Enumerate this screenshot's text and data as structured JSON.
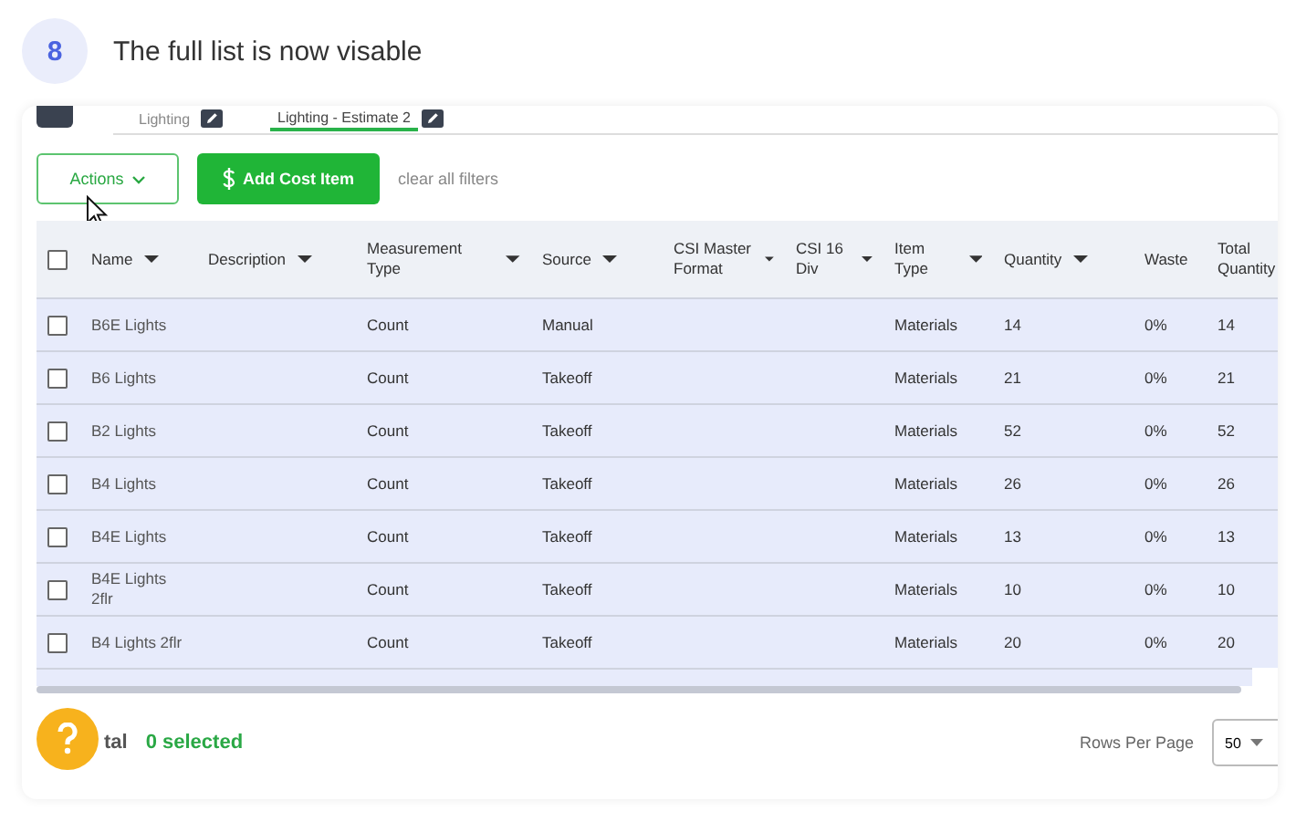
{
  "step": {
    "number": "8",
    "caption": "The full list is now visable"
  },
  "tabs": [
    {
      "label": "Lighting",
      "selected": false
    },
    {
      "label": "Lighting - Estimate 2",
      "selected": true
    }
  ],
  "toolbar": {
    "actions": "Actions",
    "add": "Add Cost Item",
    "clear": "clear all filters"
  },
  "table": {
    "select_all": {
      "checked": false
    },
    "columns": [
      {
        "label": "Name",
        "filter": true
      },
      {
        "label": "Description",
        "filter": true
      },
      {
        "label": "Measurement Type",
        "filter": true
      },
      {
        "label": "Source",
        "filter": true
      },
      {
        "label": "CSI Master Format",
        "filter": true
      },
      {
        "label": "CSI 16 Div",
        "filter": true
      },
      {
        "label": "Item Type",
        "filter": true
      },
      {
        "label": "Quantity",
        "filter": true
      },
      {
        "label": "Waste",
        "filter": false
      },
      {
        "label": "Total Quantity",
        "filter": false
      }
    ],
    "rows": [
      {
        "checked": false,
        "cells": [
          "B6E Lights",
          "",
          "Count",
          "Manual",
          "",
          "",
          "Materials",
          "14",
          "0%",
          "14"
        ]
      },
      {
        "checked": false,
        "cells": [
          "B6 Lights",
          "",
          "Count",
          "Takeoff",
          "",
          "",
          "Materials",
          "21",
          "0%",
          "21"
        ]
      },
      {
        "checked": false,
        "cells": [
          "B2 Lights",
          "",
          "Count",
          "Takeoff",
          "",
          "",
          "Materials",
          "52",
          "0%",
          "52"
        ]
      },
      {
        "checked": false,
        "cells": [
          "B4 Lights",
          "",
          "Count",
          "Takeoff",
          "",
          "",
          "Materials",
          "26",
          "0%",
          "26"
        ]
      },
      {
        "checked": false,
        "cells": [
          "B4E Lights",
          "",
          "Count",
          "Takeoff",
          "",
          "",
          "Materials",
          "13",
          "0%",
          "13"
        ]
      },
      {
        "checked": false,
        "cells": [
          "B4E Lights 2flr",
          "",
          "Count",
          "Takeoff",
          "",
          "",
          "Materials",
          "10",
          "0%",
          "10"
        ]
      },
      {
        "checked": false,
        "cells": [
          "B4 Lights 2flr",
          "",
          "Count",
          "Takeoff",
          "",
          "",
          "Materials",
          "20",
          "0%",
          "20"
        ]
      }
    ]
  },
  "footer": {
    "total": "tal",
    "selected": "0 selected",
    "rows_label": "Rows Per Page",
    "rows_value": "50"
  }
}
